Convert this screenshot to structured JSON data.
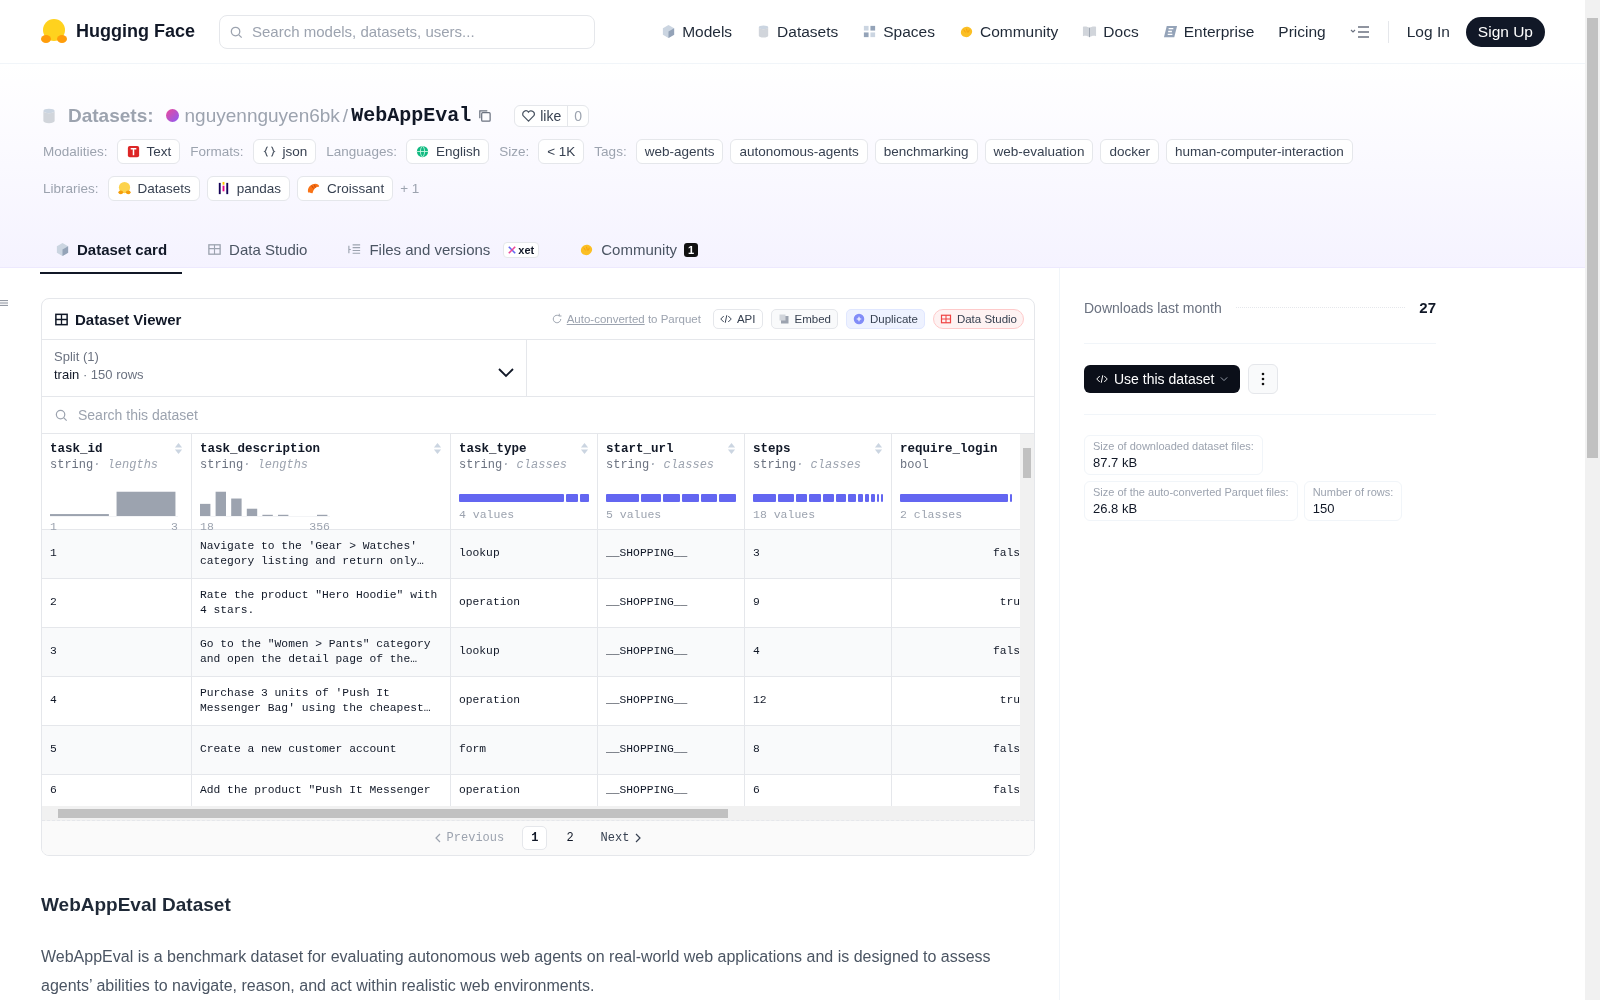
{
  "nav": {
    "brand": "Hugging Face",
    "search_placeholder": "Search models, datasets, users...",
    "links": [
      {
        "label": "Models",
        "kind": "cube"
      },
      {
        "label": "Datasets",
        "kind": "db"
      },
      {
        "label": "Spaces",
        "kind": "grid"
      },
      {
        "label": "Community",
        "kind": "hand"
      },
      {
        "label": "Docs",
        "kind": "book"
      },
      {
        "label": "Enterprise",
        "kind": "e"
      },
      {
        "label": "Pricing"
      }
    ],
    "login": "Log In",
    "signup": "Sign Up"
  },
  "header": {
    "section": "Datasets:",
    "owner": "nguyennguyen6bk",
    "separator": "/",
    "name": "WebAppEval",
    "like_label": "like",
    "like_count": "0",
    "tag_groups": [
      {
        "label": "Modalities:",
        "tags": [
          {
            "label": "Text",
            "kind": "text"
          }
        ]
      },
      {
        "label": "Formats:",
        "tags": [
          {
            "label": "json",
            "kind": "braces"
          }
        ]
      },
      {
        "label": "Languages:",
        "tags": [
          {
            "label": "English",
            "kind": "globe"
          }
        ]
      },
      {
        "label": "Size:",
        "tags": [
          {
            "label": "< 1K"
          }
        ]
      },
      {
        "label": "Tags:",
        "tags": [
          {
            "label": "web-agents"
          },
          {
            "label": "autonomous-agents"
          },
          {
            "label": "benchmarking"
          },
          {
            "label": "web-evaluation"
          },
          {
            "label": "docker"
          },
          {
            "label": "human-computer-interaction"
          }
        ]
      }
    ],
    "libraries": {
      "label": "Libraries:",
      "tags": [
        {
          "label": "Datasets",
          "kind": "hf"
        },
        {
          "label": "pandas",
          "kind": "pandas"
        },
        {
          "label": "Croissant",
          "kind": "croissant"
        }
      ],
      "more": "+ 1"
    },
    "tabs": [
      {
        "label": "Dataset card",
        "kind": "cube",
        "selected": true
      },
      {
        "label": "Data Studio",
        "kind": "table",
        "selected": false
      },
      {
        "label": "Files and versions",
        "kind": "files",
        "selected": false,
        "badge": "xet"
      },
      {
        "label": "Community",
        "kind": "hand",
        "selected": false,
        "count": "1"
      }
    ]
  },
  "viewer": {
    "title": "Dataset Viewer",
    "converted_link": "Auto-converted",
    "converted_rest": "to Parquet",
    "buttons": [
      {
        "label": "API",
        "kind": "api"
      },
      {
        "label": "Embed",
        "kind": "embed"
      },
      {
        "label": "Duplicate",
        "kind": "duplicate"
      },
      {
        "label": "Data Studio",
        "kind": "studio"
      }
    ],
    "split": {
      "label": "Split (1)",
      "name": "train",
      "rows": "· 150 rows"
    },
    "search_placeholder": "Search this dataset",
    "columns": [
      {
        "name": "task_id",
        "dtype": "string",
        "stat": "· lengths",
        "kind": "hist",
        "min": "1",
        "max": "3"
      },
      {
        "name": "task_description",
        "dtype": "string",
        "stat": "· lengths",
        "kind": "hist",
        "min": "18",
        "max": "356"
      },
      {
        "name": "task_type",
        "dtype": "string",
        "stat": "· classes",
        "kind": "classes",
        "summary": "4 values"
      },
      {
        "name": "start_url",
        "dtype": "string",
        "stat": "· classes",
        "kind": "classes",
        "summary": "5 values"
      },
      {
        "name": "steps",
        "dtype": "string",
        "stat": "· classes",
        "kind": "classes",
        "summary": "18 values"
      },
      {
        "name": "require_login",
        "dtype": "bool",
        "kind": "bool",
        "summary": "2 classes"
      }
    ],
    "rows": [
      [
        "1",
        "Navigate to the 'Gear > Watches' category listing and return only…",
        "lookup",
        "__SHOPPING__",
        "3",
        "fals"
      ],
      [
        "2",
        "Rate the product \"Hero Hoodie\" with 4 stars.",
        "operation",
        "__SHOPPING__",
        "9",
        "tru"
      ],
      [
        "3",
        "Go to the \"Women > Pants\" category and open the detail page of the…",
        "lookup",
        "__SHOPPING__",
        "4",
        "fals"
      ],
      [
        "4",
        "Purchase 3 units of 'Push It Messenger Bag' using the cheapest…",
        "operation",
        "__SHOPPING__",
        "12",
        "tru"
      ],
      [
        "5",
        "Create a new customer account",
        "form",
        "__SHOPPING__",
        "8",
        "fals"
      ],
      [
        "6",
        "Add the product \"Push It Messenger",
        "operation",
        "__SHOPPING__",
        "6",
        "fals"
      ]
    ],
    "pagination": {
      "previous": "Previous",
      "pages": [
        {
          "label": "1",
          "selected": true
        },
        {
          "label": "2",
          "selected": false
        }
      ],
      "next": "Next"
    }
  },
  "readme": {
    "heading": "WebAppEval Dataset",
    "paragraph": "WebAppEval is a benchmark dataset for evaluating autonomous web agents on real-world web applications and is designed to assess agents’ abilities to navigate, reason, and act within realistic web environments."
  },
  "sidebar": {
    "downloads_label": "Downloads last month",
    "downloads": "27",
    "use_button": "Use this dataset",
    "stats": [
      {
        "label": "Size of downloaded dataset files:",
        "value": "87.7 kB"
      },
      {
        "label": "Size of the auto-converted Parquet files:",
        "value": "26.8 kB"
      },
      {
        "label": "Number of rows:",
        "value": "150"
      }
    ]
  }
}
